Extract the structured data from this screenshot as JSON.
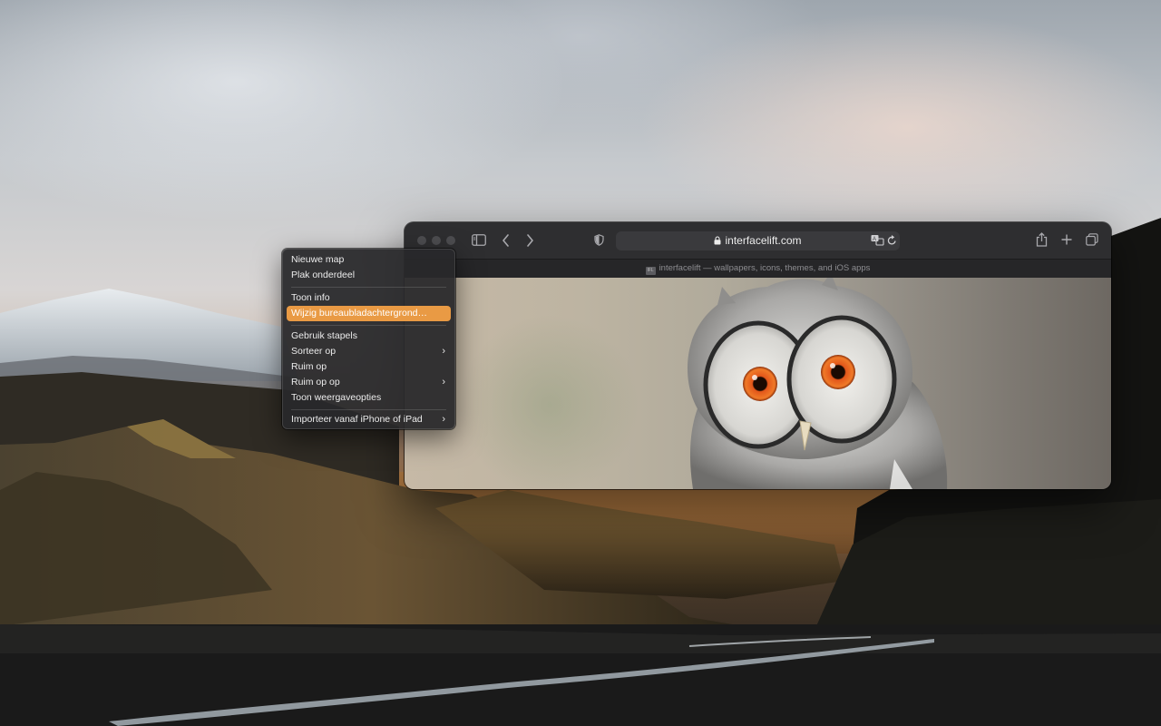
{
  "safari": {
    "address": "interfacelift.com",
    "tab_title": "interfacelift — wallpapers, icons, themes, and iOS apps",
    "favicon_text": "IFL"
  },
  "context_menu": {
    "items": [
      {
        "label": "Nieuwe map",
        "submenu": false,
        "highlighted": false
      },
      {
        "label": "Plak onderdeel",
        "submenu": false,
        "highlighted": false
      },
      {
        "label": "Toon info",
        "submenu": false,
        "highlighted": false
      },
      {
        "label": "Wijzig bureaubladachtergrond…",
        "submenu": false,
        "highlighted": true
      },
      {
        "label": "Gebruik stapels",
        "submenu": false,
        "highlighted": false
      },
      {
        "label": "Sorteer op",
        "submenu": true,
        "highlighted": false
      },
      {
        "label": "Ruim op",
        "submenu": false,
        "highlighted": false
      },
      {
        "label": "Ruim op op",
        "submenu": true,
        "highlighted": false
      },
      {
        "label": "Toon weergaveopties",
        "submenu": false,
        "highlighted": false
      },
      {
        "label": "Importeer vanaf iPhone of iPad",
        "submenu": true,
        "highlighted": false
      }
    ],
    "highlight_color": "#e99a44"
  },
  "icons": {
    "sidebar": "sidebar-icon",
    "back": "chevron-left-icon",
    "forward": "chevron-right-icon",
    "privacy": "shield-icon",
    "lock": "lock-icon",
    "translate": "translate-icon",
    "reload": "reload-icon",
    "share": "share-icon",
    "new_tab": "plus-icon",
    "tab_overview": "tab-overview-icon"
  }
}
